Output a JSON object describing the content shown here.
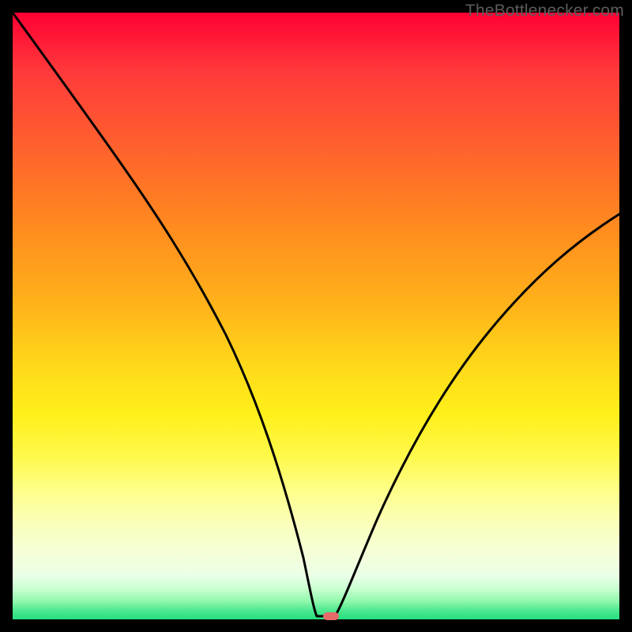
{
  "watermark": "TheBottlenecker.com",
  "colors": {
    "marker": "#e66a6a",
    "curve_stroke": "#000000"
  },
  "chart_data": {
    "type": "line",
    "title": "",
    "xlabel": "",
    "ylabel": "",
    "xlim": [
      0,
      100
    ],
    "ylim": [
      0,
      100
    ],
    "grid": false,
    "legend": false,
    "x": [
      0,
      5,
      10,
      15,
      20,
      25,
      30,
      35,
      40,
      45,
      48,
      50,
      52,
      53,
      55,
      60,
      65,
      70,
      75,
      80,
      85,
      90,
      95,
      100
    ],
    "values": [
      100,
      92,
      84,
      76,
      68,
      60,
      50,
      40,
      28,
      14,
      5,
      1,
      0,
      0,
      3,
      12,
      21,
      30,
      38,
      45,
      52,
      58,
      63,
      67
    ],
    "min_marker": {
      "x": 52.5,
      "y": 0
    },
    "annotations": []
  }
}
